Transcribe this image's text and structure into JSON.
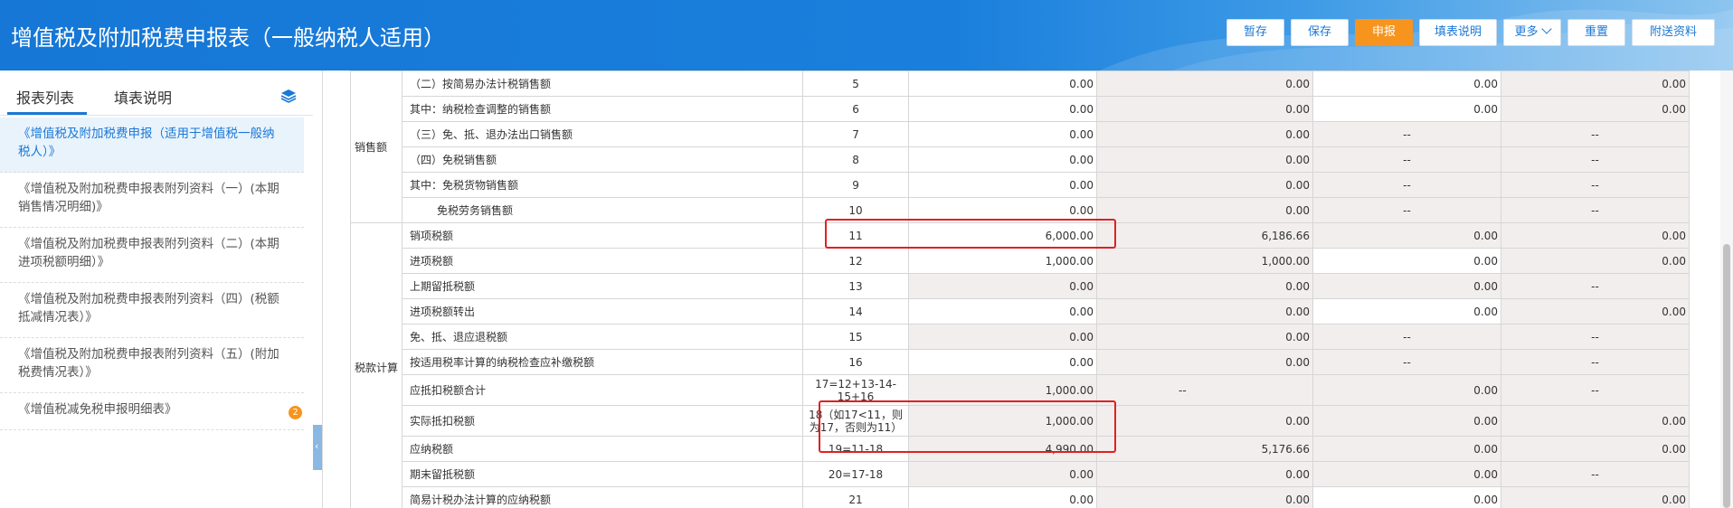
{
  "header": {
    "title": "增值税及附加税费申报表（一般纳税人适用）",
    "buttons": {
      "save_draft": "暂存",
      "save": "保存",
      "declare": "申报",
      "fill_help": "填表说明",
      "more": "更多",
      "reset": "重置",
      "attach": "附送资料"
    }
  },
  "sidebar": {
    "tab_list": "报表列表",
    "tab_help": "填表说明",
    "items": [
      {
        "label": "《增值税及附加税费申报（适用于增值税一般纳税人）》"
      },
      {
        "label": "《增值税及附加税费申报表附列资料（一）(本期销售情况明细)》"
      },
      {
        "label": "《增值税及附加税费申报表附列资料（二）(本期进项税额明细）》"
      },
      {
        "label": "《增值税及附加税费申报表附列资料（四）(税额抵减情况表）》"
      },
      {
        "label": "《增值税及附加税费申报表附列资料（五）(附加税费情况表）》"
      },
      {
        "label": "《增值税减免税申报明细表》",
        "badge": "2"
      }
    ],
    "collapse_glyph": "‹"
  },
  "table": {
    "groups": [
      {
        "category": "销售额",
        "rows": [
          {
            "name": "（二）按简易办法计税销售额",
            "no": "5",
            "c1": "0.00",
            "c2": "0.00",
            "c3": "0.00",
            "c4": "0.00",
            "bg": [
              "white",
              "grey",
              "white",
              "grey"
            ]
          },
          {
            "name": "其中：纳税检查调整的销售额",
            "no": "6",
            "c1": "0.00",
            "c2": "0.00",
            "c3": "0.00",
            "c4": "0.00",
            "bg": [
              "white",
              "grey",
              "white",
              "grey"
            ]
          },
          {
            "name": "（三）免、抵、退办法出口销售额",
            "no": "7",
            "c1": "0.00",
            "c2": "0.00",
            "c3": "--",
            "c4": "--",
            "bg": [
              "white",
              "grey",
              "grey",
              "grey"
            ]
          },
          {
            "name": "（四）免税销售额",
            "no": "8",
            "c1": "0.00",
            "c2": "0.00",
            "c3": "--",
            "c4": "--",
            "bg": [
              "white",
              "grey",
              "grey",
              "grey"
            ]
          },
          {
            "name": "其中：免税货物销售额",
            "no": "9",
            "c1": "0.00",
            "c2": "0.00",
            "c3": "--",
            "c4": "--",
            "bg": [
              "white",
              "grey",
              "grey",
              "grey"
            ]
          },
          {
            "name": "免税劳务销售额",
            "no": "10",
            "indent": true,
            "c1": "0.00",
            "c2": "0.00",
            "c3": "--",
            "c4": "--",
            "bg": [
              "white",
              "grey",
              "grey",
              "grey"
            ]
          }
        ]
      },
      {
        "category": "税款计算",
        "rows": [
          {
            "name": "销项税额",
            "no": "11",
            "c1": "6,000.00",
            "c2": "6,186.66",
            "c3": "0.00",
            "c4": "0.00",
            "bg": [
              "white",
              "grey",
              "grey",
              "grey"
            ]
          },
          {
            "name": "进项税额",
            "no": "12",
            "c1": "1,000.00",
            "c2": "1,000.00",
            "c3": "0.00",
            "c4": "0.00",
            "bg": [
              "white",
              "grey",
              "white",
              "grey"
            ]
          },
          {
            "name": "上期留抵税额",
            "no": "13",
            "c1": "0.00",
            "c2": "0.00",
            "c3": "0.00",
            "c4": "--",
            "bg": [
              "grey",
              "grey",
              "grey",
              "grey"
            ]
          },
          {
            "name": "进项税额转出",
            "no": "14",
            "c1": "0.00",
            "c2": "0.00",
            "c3": "0.00",
            "c4": "0.00",
            "bg": [
              "white",
              "grey",
              "white",
              "grey"
            ]
          },
          {
            "name": "免、抵、退应退税额",
            "no": "15",
            "c1": "0.00",
            "c2": "0.00",
            "c3": "--",
            "c4": "--",
            "bg": [
              "grey",
              "grey",
              "grey",
              "grey"
            ]
          },
          {
            "name": "按适用税率计算的纳税检查应补缴税额",
            "no": "16",
            "c1": "0.00",
            "c2": "0.00",
            "c3": "--",
            "c4": "--",
            "bg": [
              "white",
              "grey",
              "grey",
              "grey"
            ]
          },
          {
            "name": "应抵扣税额合计",
            "no": "17=12+13-14-15+16",
            "multi": true,
            "c1": "1,000.00",
            "c2": "--",
            "c3": "0.00",
            "c4": "--",
            "bg": [
              "grey",
              "grey",
              "grey",
              "grey"
            ],
            "c2dash": true
          },
          {
            "name": "实际抵扣税额",
            "no": "18（如17<11，则为17，否则为11）",
            "multi": true,
            "c1": "1,000.00",
            "c2": "0.00",
            "c3": "0.00",
            "c4": "0.00",
            "bg": [
              "grey",
              "grey",
              "grey",
              "grey"
            ]
          },
          {
            "name": "应纳税额",
            "no": "19=11-18",
            "c1": "4,990.00",
            "c2": "5,176.66",
            "c3": "0.00",
            "c4": "0.00",
            "bg": [
              "grey",
              "grey",
              "grey",
              "grey"
            ]
          },
          {
            "name": "期末留抵税额",
            "no": "20=17-18",
            "c1": "0.00",
            "c2": "0.00",
            "c3": "0.00",
            "c4": "--",
            "bg": [
              "grey",
              "grey",
              "grey",
              "grey"
            ]
          },
          {
            "name": "简易计税办法计算的应纳税额",
            "no": "21",
            "c1": "0.00",
            "c2": "0.00",
            "c3": "0.00",
            "c4": "0.00",
            "bg": [
              "white",
              "grey",
              "white",
              "grey"
            ]
          }
        ]
      }
    ]
  }
}
